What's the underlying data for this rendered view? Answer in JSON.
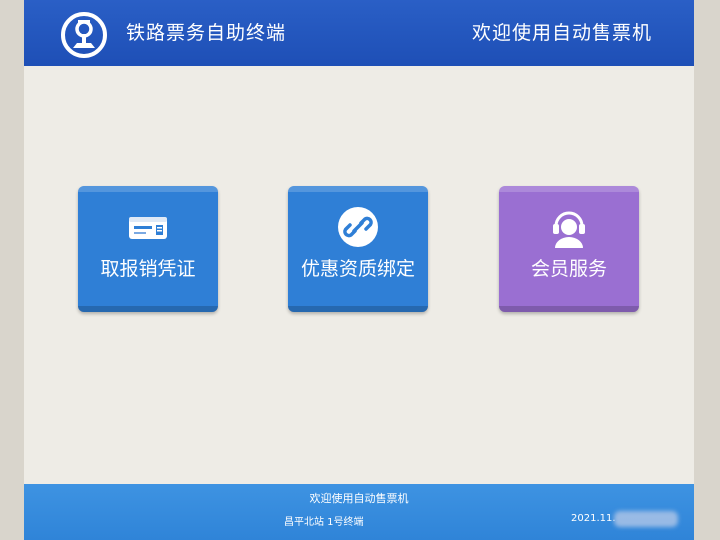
{
  "header": {
    "app_title": "铁路票务自助终端",
    "welcome": "欢迎使用自动售票机",
    "logo_icon": "china-railway-logo-icon"
  },
  "tiles": [
    {
      "label": "取报销凭证",
      "icon": "ticket-id-card-icon",
      "color": "#2f7fd6"
    },
    {
      "label": "优惠资质绑定",
      "icon": "link-icon",
      "color": "#2f7fd6"
    },
    {
      "label": "会员服务",
      "icon": "headset-agent-icon",
      "color": "#9a6fd2"
    }
  ],
  "footer": {
    "welcome": "欢迎使用自动售票机",
    "station": "昌平北站 1号终端",
    "date": "2021.11."
  },
  "colors": {
    "header_bg": "#1e4fb6",
    "footer_bg": "#2f84d8",
    "screen_bg": "#eeece6"
  }
}
